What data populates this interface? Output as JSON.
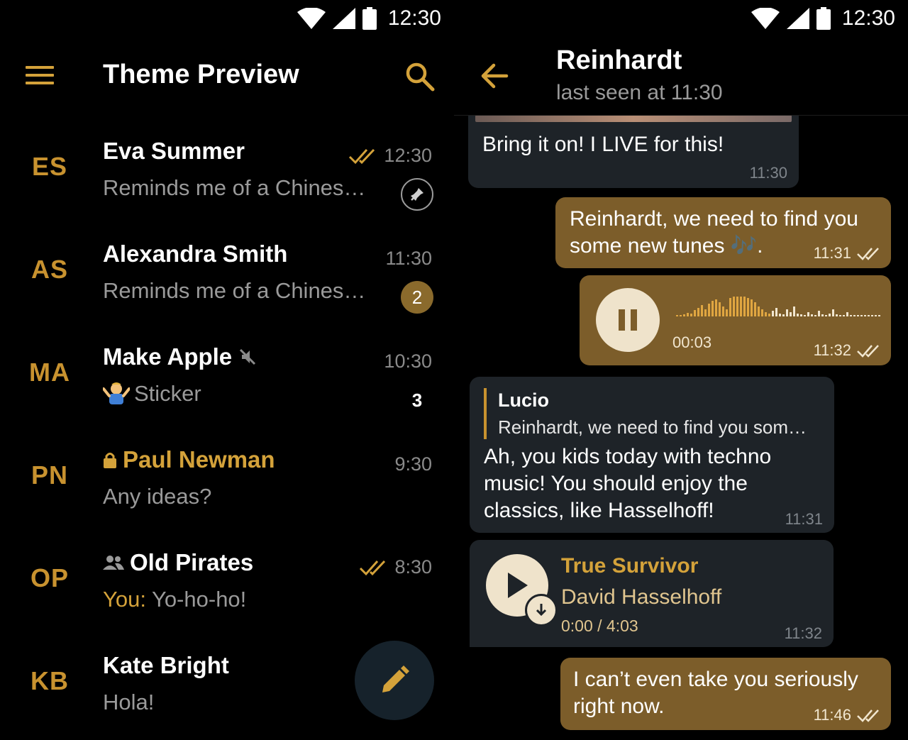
{
  "status": {
    "time": "12:30"
  },
  "list": {
    "title": "Theme Preview",
    "chats": [
      {
        "initials": "ES",
        "name": "Eva Summer",
        "preview": "Reminds me of a Chines…",
        "time": "12:30"
      },
      {
        "initials": "AS",
        "name": "Alexandra Smith",
        "preview": "Reminds me of a Chines…",
        "time": "11:30",
        "unread": "2"
      },
      {
        "initials": "MA",
        "name": "Make Apple",
        "preview": "Sticker",
        "time": "10:30",
        "unread": "3"
      },
      {
        "initials": "PN",
        "name": "Paul Newman",
        "preview": "Any ideas?",
        "time": "9:30"
      },
      {
        "initials": "OP",
        "name": "Old Pirates",
        "preview_prefix": "You:",
        "preview": " Yo-ho-ho!",
        "time": "8:30"
      },
      {
        "initials": "KB",
        "name": "Kate Bright",
        "preview": "Hola!"
      }
    ]
  },
  "chat": {
    "name": "Reinhardt",
    "status": "last seen at 11:30",
    "messages": [
      {
        "text": "Bring it on! I LIVE for this!",
        "time": "11:30"
      },
      {
        "line1": "Reinhardt, we need to find you",
        "line2": "some new tunes 🎶.",
        "time": "11:31"
      },
      {
        "duration": "00:03",
        "time": "11:32"
      },
      {
        "reply_name": "Lucio",
        "reply_text": "Reinhardt, we need to find you som…",
        "line1": "Ah, you kids today with techno",
        "line2": "music! You should enjoy the",
        "line3": "classics, like Hasselhoff!",
        "time": "11:31"
      },
      {
        "title": "True Survivor",
        "artist": "David Hasselhoff",
        "progress": "0:00 / 4:03",
        "time": "11:32"
      },
      {
        "line1": "I can’t even take you seriously",
        "line2": "right now.",
        "time": "11:46"
      }
    ]
  },
  "colors": {
    "accent": "#d4a23a",
    "outgoing": "#7c5d2a",
    "incoming": "#1e2328"
  }
}
